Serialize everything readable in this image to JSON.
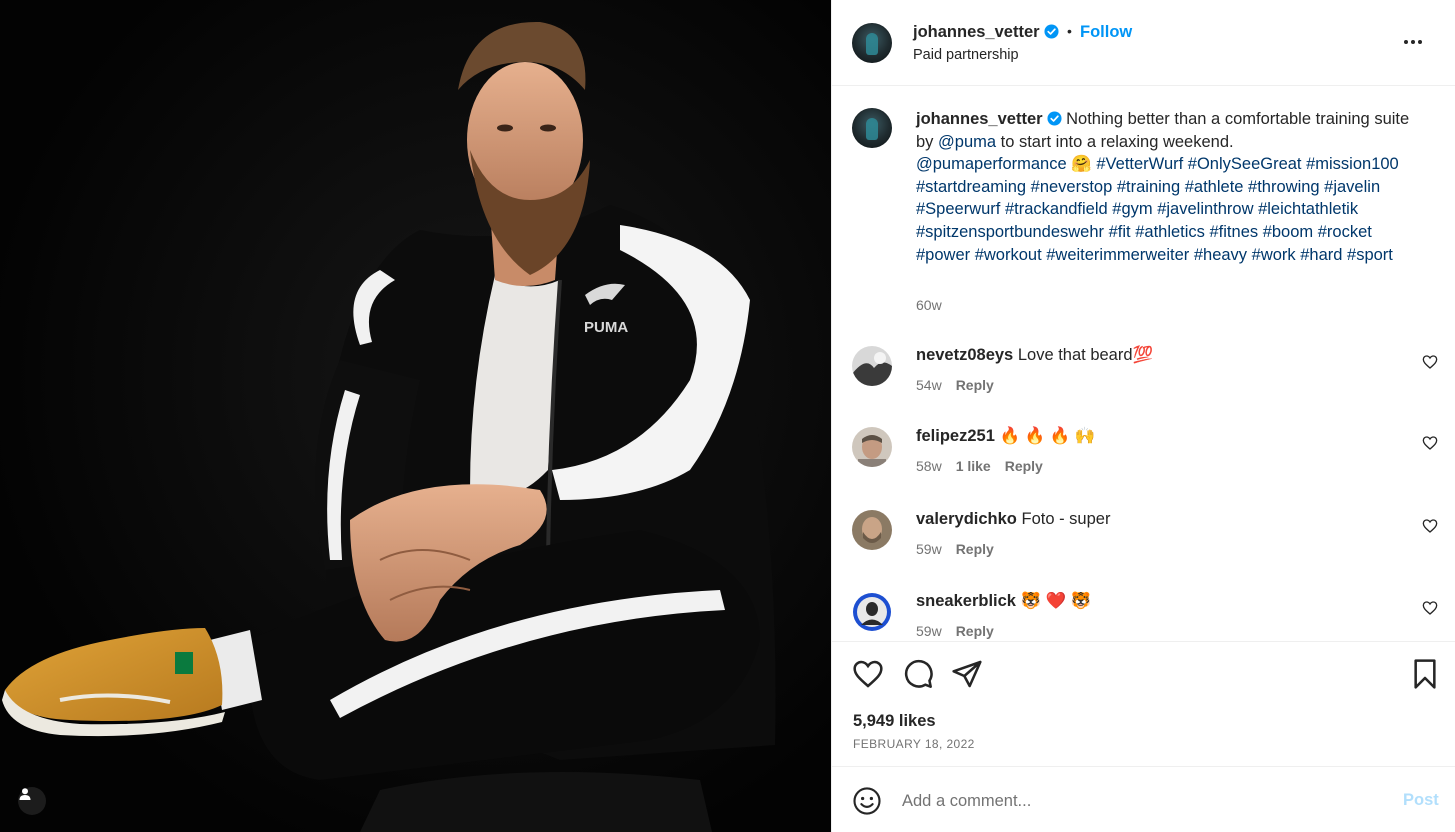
{
  "post": {
    "username": "johannes_vetter",
    "verified": true,
    "follow_label": "Follow",
    "separator": "•",
    "subtitle": "Paid partnership",
    "more_icon": "more-horizontal-icon"
  },
  "caption": {
    "username": "johannes_vetter",
    "text_1": " Nothing better than a comfortable training suite by ",
    "mention_1": "@puma",
    "text_2": " to start into a relaxing weekend. ",
    "mention_2": "@pumaperformance",
    "emoji_1": " 🤗 ",
    "hashtags": "#VetterWurf #OnlySeeGreat #mission100 #startdreaming #neverstop #training #athlete #throwing #javelin #Speerwurf #trackandfield #gym #javelinthrow #leichtathletik #spitzensportbundeswehr #fit #athletics #fitnes #boom #rocket #power #workout #weiterimmerweiter #heavy #work #hard #sport",
    "time": "60w"
  },
  "comments": [
    {
      "username": "nevetz08eys",
      "text": "Love that beard💯",
      "time": "54w",
      "likes": "",
      "reply": "Reply"
    },
    {
      "username": "felipez251",
      "text": "🔥 🔥 🔥 🙌",
      "time": "58w",
      "likes": "1 like",
      "reply": "Reply"
    },
    {
      "username": "valerydichko",
      "text": "Foto - super",
      "time": "59w",
      "likes": "",
      "reply": "Reply"
    },
    {
      "username": "sneakerblick",
      "text": "🐯 ❤️ 🐯",
      "time": "59w",
      "likes": "",
      "reply": "Reply"
    }
  ],
  "actions": {
    "like_icon": "heart-icon",
    "comment_icon": "comment-icon",
    "share_icon": "share-icon",
    "save_icon": "bookmark-icon",
    "likes": "5,949 likes",
    "date": "FEBRUARY 18, 2022"
  },
  "add_comment": {
    "placeholder": "Add a comment...",
    "post_label": "Post",
    "emoji_icon": "emoji-icon"
  },
  "photo": {
    "tag_icon": "user-tag-icon",
    "brand_text": "PUMA"
  },
  "colors": {
    "link": "#00376b",
    "follow": "#0095f6",
    "post_disabled": "#b2dffc",
    "muted": "#737373",
    "photo_bg": "#050505"
  }
}
